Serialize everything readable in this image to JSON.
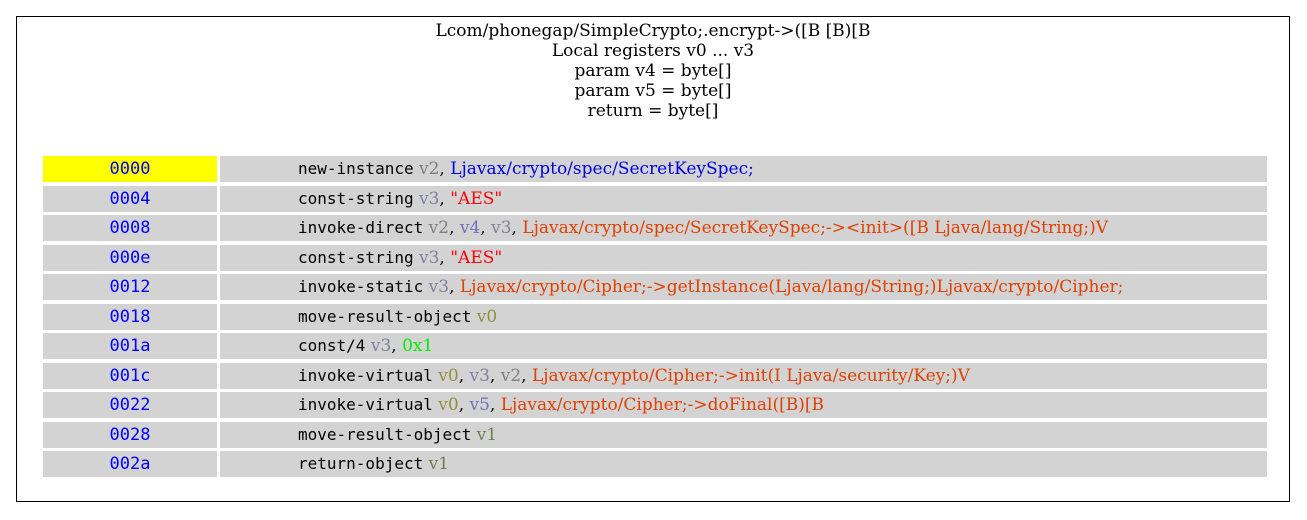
{
  "header": {
    "lines": [
      "Lcom/phonegap/SimpleCrypto;.encrypt->([B [B)[B",
      "Local registers v0 ... v3",
      "param v4 = byte[]",
      "param v5 = byte[]",
      "return = byte[]"
    ]
  },
  "colors": {
    "address": "#0000ff",
    "address_highlight_bg": "#ffff00",
    "row_bg": "#d3d3d3",
    "reg_v0_v1": "#808040",
    "reg_v2_v3": "#8080a0",
    "reg_v4_v5": "#7070c0",
    "type_ref": "#0000cc",
    "method_ref": "#e04000",
    "string": "#ff0000",
    "literal": "#00ee00"
  },
  "instructions": [
    {
      "addr": "0000",
      "highlight": true,
      "op": "new-instance",
      "args": [
        {
          "t": "v2",
          "c": "#808080"
        },
        {
          "t": "Ljavax/crypto/spec/SecretKeySpec;",
          "c": "#0000dd"
        }
      ]
    },
    {
      "addr": "0004",
      "highlight": false,
      "op": "const-string",
      "args": [
        {
          "t": "v3",
          "c": "#8080a0"
        },
        {
          "t": "\"AES\"",
          "c": "#ff0000"
        }
      ]
    },
    {
      "addr": "0008",
      "highlight": false,
      "op": "invoke-direct",
      "args": [
        {
          "t": "v2",
          "c": "#808080"
        },
        {
          "t": "v4",
          "c": "#7070c0"
        },
        {
          "t": "v3",
          "c": "#8080a0"
        },
        {
          "t": "Ljavax/crypto/spec/SecretKeySpec;-><init>([B Ljava/lang/String;)V",
          "c": "#e04000"
        }
      ]
    },
    {
      "addr": "000e",
      "highlight": false,
      "op": "const-string",
      "args": [
        {
          "t": "v3",
          "c": "#8080a0"
        },
        {
          "t": "\"AES\"",
          "c": "#ff0000"
        }
      ]
    },
    {
      "addr": "0012",
      "highlight": false,
      "op": "invoke-static",
      "args": [
        {
          "t": "v3",
          "c": "#8080a0"
        },
        {
          "t": "Ljavax/crypto/Cipher;->getInstance(Ljava/lang/String;)Ljavax/crypto/Cipher;",
          "c": "#e04000"
        }
      ]
    },
    {
      "addr": "0018",
      "highlight": false,
      "op": "move-result-object",
      "args": [
        {
          "t": "v0",
          "c": "#909040"
        }
      ]
    },
    {
      "addr": "001a",
      "highlight": false,
      "op": "const/4",
      "args": [
        {
          "t": "v3",
          "c": "#8080a0"
        },
        {
          "t": "0x1",
          "c": "#00ee00"
        }
      ]
    },
    {
      "addr": "001c",
      "highlight": false,
      "op": "invoke-virtual",
      "args": [
        {
          "t": "v0",
          "c": "#909040"
        },
        {
          "t": "v3",
          "c": "#8080a0"
        },
        {
          "t": "v2",
          "c": "#808080"
        },
        {
          "t": "Ljavax/crypto/Cipher;->init(I Ljava/security/Key;)V",
          "c": "#e04000"
        }
      ]
    },
    {
      "addr": "0022",
      "highlight": false,
      "op": "invoke-virtual",
      "args": [
        {
          "t": "v0",
          "c": "#909040"
        },
        {
          "t": "v5",
          "c": "#7070c0"
        },
        {
          "t": "Ljavax/crypto/Cipher;->doFinal([B)[B",
          "c": "#e04000"
        }
      ]
    },
    {
      "addr": "0028",
      "highlight": false,
      "op": "move-result-object",
      "args": [
        {
          "t": "v1",
          "c": "#708050"
        }
      ]
    },
    {
      "addr": "002a",
      "highlight": false,
      "op": "return-object",
      "args": [
        {
          "t": "v1",
          "c": "#708050"
        }
      ]
    }
  ]
}
